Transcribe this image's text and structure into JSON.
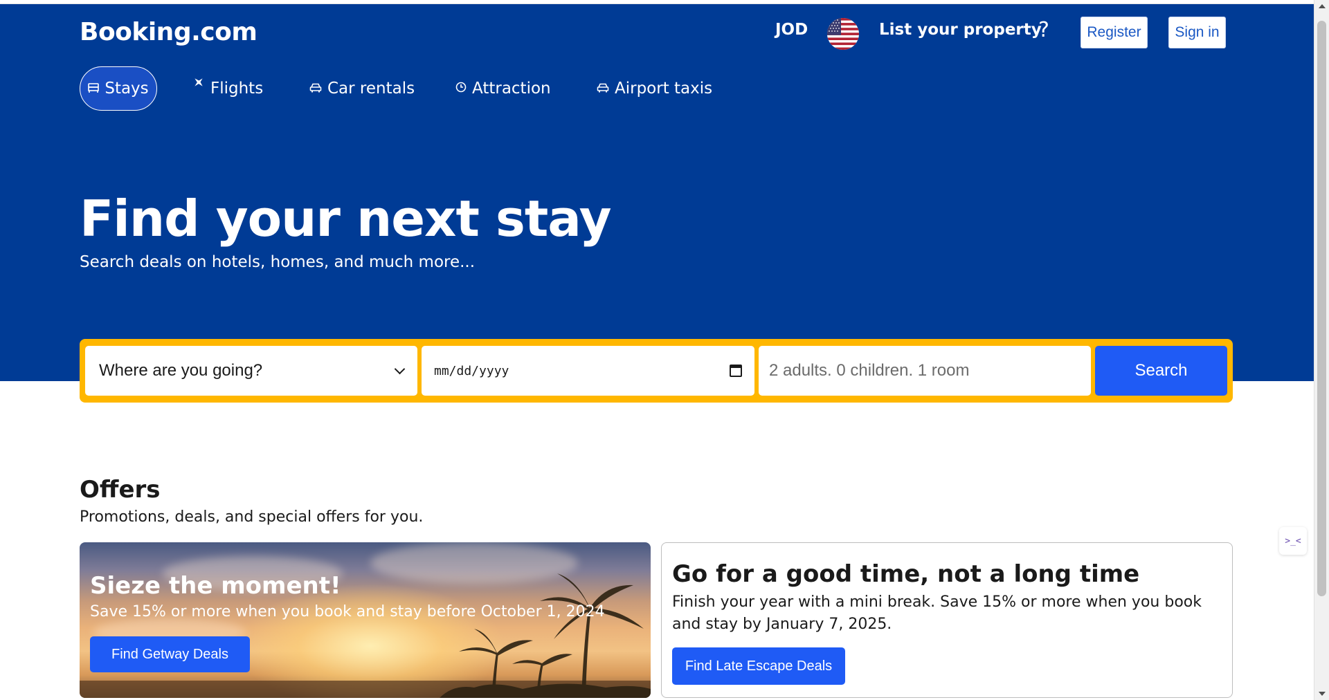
{
  "header": {
    "logo": "Booking.com",
    "currency": "JOD",
    "list_property": "List your property",
    "help": "?",
    "register": "Register",
    "sign_in": "Sign in"
  },
  "nav": {
    "items": [
      {
        "label": "Stays",
        "icon": "bed-icon",
        "active": true
      },
      {
        "label": "Flights",
        "icon": "plane-icon",
        "active": false
      },
      {
        "label": "Car rentals",
        "icon": "car-icon",
        "active": false
      },
      {
        "label": "Attraction",
        "icon": "clock-icon",
        "active": false
      },
      {
        "label": "Airport taxis",
        "icon": "taxi-icon",
        "active": false
      }
    ]
  },
  "hero": {
    "title": "Find your next stay",
    "subtitle": "Search deals on hotels, homes, and much more..."
  },
  "search": {
    "destination": "Where are you going?",
    "date_placeholder": "mm/dd/yyyy",
    "guests": "2 adults. 0 children. 1 room",
    "button": "Search"
  },
  "offers": {
    "title": "Offers",
    "subtitle": "Promotions, deals, and special offers for you.",
    "cards": [
      {
        "title": "Sieze the moment!",
        "text": "Save 15% or more when you book and stay before October 1, 2024",
        "button": "Find Getway Deals"
      },
      {
        "title": "Go for a good time, not a long time",
        "text": "Finish your year with a mini break. Save 15% or more when you book and stay by January 7, 2025.",
        "button": "Find Late Escape Deals"
      }
    ]
  },
  "side_widget": {
    "label": ">_<"
  },
  "colors": {
    "brand_blue": "#003b95",
    "action_blue": "#1f5bf5",
    "search_yellow": "#ffb700"
  }
}
